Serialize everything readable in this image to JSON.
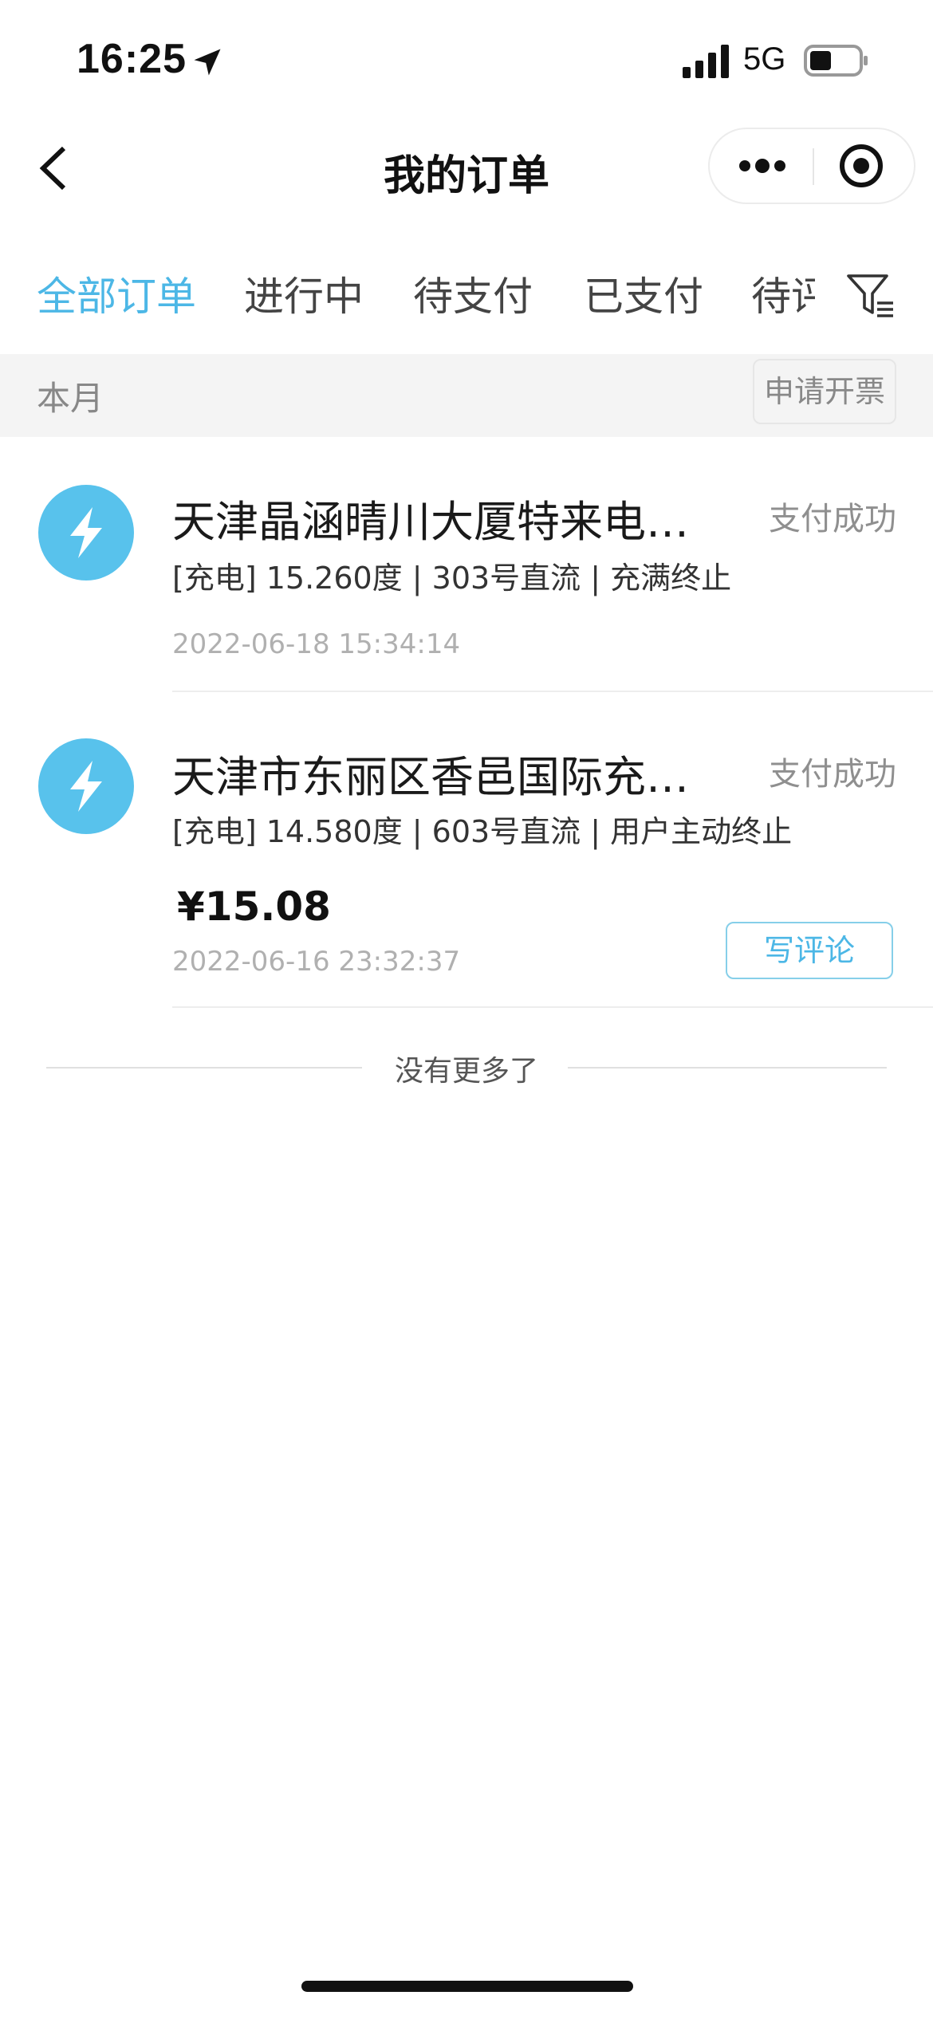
{
  "status_bar": {
    "time": "16:25",
    "network": "5G"
  },
  "nav": {
    "title": "我的订单"
  },
  "tabs": [
    {
      "label": "全部订单",
      "active": true
    },
    {
      "label": "进行中",
      "active": false
    },
    {
      "label": "待支付",
      "active": false
    },
    {
      "label": "已支付",
      "active": false
    },
    {
      "label": "待评价",
      "active": false
    }
  ],
  "month_section": {
    "label": "本月",
    "invoice_label": "申请开票"
  },
  "orders": [
    {
      "title": "天津晶涵晴川大厦特来电充…",
      "status": "支付成功",
      "detail": "[充电] 15.260度 | 303号直流 | 充满终止",
      "time": "2022-06-18 15:34:14"
    },
    {
      "title": "天津市东丽区香邑国际充电站",
      "status": "支付成功",
      "detail": "[充电] 14.580度 | 603号直流 | 用户主动终止",
      "price": "¥15.08",
      "time": "2022-06-16 23:32:37",
      "review_label": "写评论"
    }
  ],
  "list_end": "没有更多了",
  "colors": {
    "accent": "#4cb7e6",
    "icon_bg": "#58c2ec",
    "muted": "#8f8f8f"
  },
  "icons": [
    "location-arrow-icon",
    "signal-icon",
    "battery-icon",
    "back-icon",
    "more-icon",
    "target-icon",
    "filter-icon",
    "lightning-icon"
  ]
}
